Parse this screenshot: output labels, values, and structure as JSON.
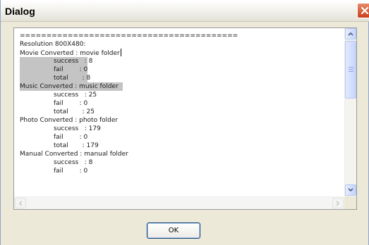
{
  "window": {
    "title": "Dialog"
  },
  "log": {
    "separator": "=========================================",
    "resolution": "Resolution 800X480:",
    "movie": {
      "heading": "Movie Converted : movie folder",
      "success": "success   : 8",
      "fail": "fail        : 0",
      "total": "total       : 8"
    },
    "music": {
      "heading": "Music Converted : music folder",
      "success": "success   : 25",
      "fail": "fail        : 0",
      "total": "total       : 25"
    },
    "photo": {
      "heading": "Photo Converted : photo folder",
      "success": "success   : 179",
      "fail": "fail        : 0",
      "total": "total       : 179"
    },
    "manual": {
      "heading": "Manual Converted : manual folder",
      "success": "success   : 8",
      "fail": "fail        : 0"
    }
  },
  "buttons": {
    "ok": "OK"
  },
  "icons": {
    "close": "close-icon",
    "scroll_up": "arrow-up-icon",
    "scroll_down": "arrow-down-icon",
    "scroll_left": "arrow-left-icon",
    "scroll_right": "arrow-right-icon"
  },
  "colors": {
    "close_button": "#c8411b",
    "selection": "#c4c4c4",
    "ok_border": "#003c74",
    "window_face": "#ece9d8"
  }
}
